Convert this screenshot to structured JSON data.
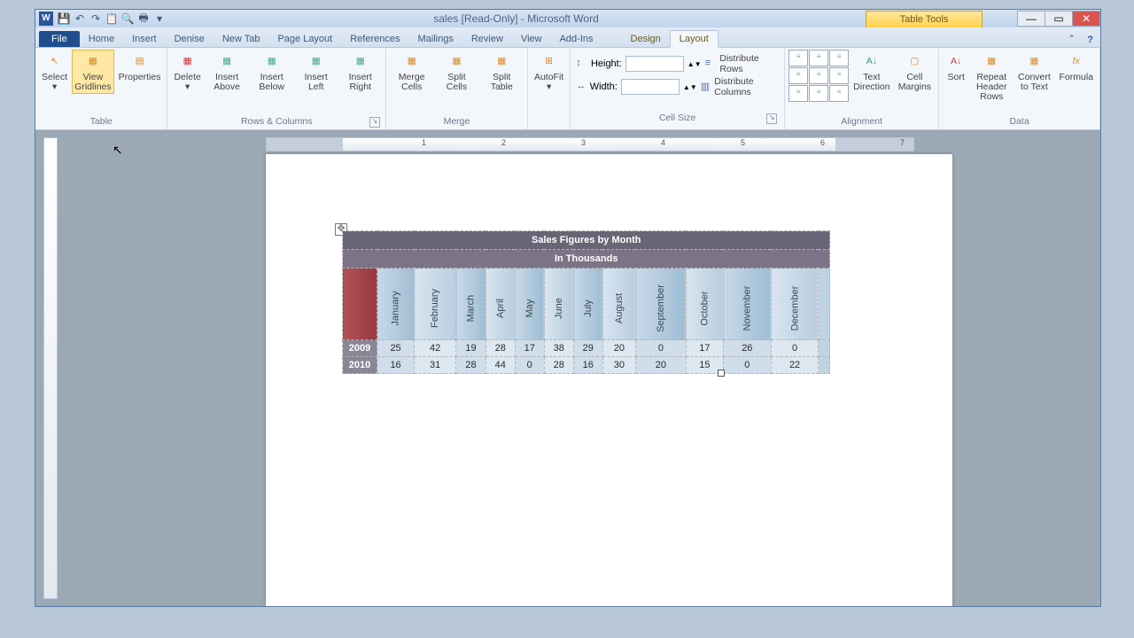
{
  "title": "sales [Read-Only] - Microsoft Word",
  "context_tab": "Table Tools",
  "win": {
    "min": "—",
    "max": "▭",
    "close": "✕"
  },
  "qat": [
    "💾",
    "↶",
    "↷",
    "📋",
    "🔍",
    "🖶"
  ],
  "tabs": {
    "file": "File",
    "home": "Home",
    "insert": "Insert",
    "denise": "Denise",
    "newtab": "New Tab",
    "pagelayout": "Page Layout",
    "references": "References",
    "mailings": "Mailings",
    "review": "Review",
    "view": "View",
    "addins": "Add-Ins",
    "design": "Design",
    "layout": "Layout"
  },
  "ribbon": {
    "table": {
      "label": "Table",
      "select": "Select",
      "gridlines": "View Gridlines",
      "properties": "Properties"
    },
    "rowscols": {
      "label": "Rows & Columns",
      "delete": "Delete",
      "above": "Insert Above",
      "below": "Insert Below",
      "left": "Insert Left",
      "right": "Insert Right"
    },
    "merge": {
      "label": "Merge",
      "merge": "Merge Cells",
      "splitc": "Split Cells",
      "splitt": "Split Table"
    },
    "autofit": "AutoFit",
    "cellsize": {
      "label": "Cell Size",
      "height": "Height:",
      "width": "Width:",
      "drows": "Distribute Rows",
      "dcols": "Distribute Columns"
    },
    "align": {
      "label": "Alignment",
      "textdir": "Text Direction",
      "margins": "Cell Margins"
    },
    "data": {
      "label": "Data",
      "sort": "Sort",
      "repeat": "Repeat Header Rows",
      "convert": "Convert to Text",
      "formula": "Formula"
    }
  },
  "ruler_corner": "L",
  "chart_data": {
    "type": "table",
    "title": "Sales Figures by Month",
    "subtitle": "In Thousands",
    "categories": [
      "January",
      "February",
      "March",
      "April",
      "May",
      "June",
      "July",
      "August",
      "September",
      "October",
      "November",
      "December"
    ],
    "series": [
      {
        "name": "2009",
        "values": [
          25,
          42,
          19,
          28,
          17,
          38,
          29,
          20,
          0,
          17,
          26,
          0
        ]
      },
      {
        "name": "2010",
        "values": [
          16,
          31,
          28,
          44,
          0,
          28,
          16,
          30,
          20,
          15,
          0,
          22
        ]
      }
    ]
  }
}
